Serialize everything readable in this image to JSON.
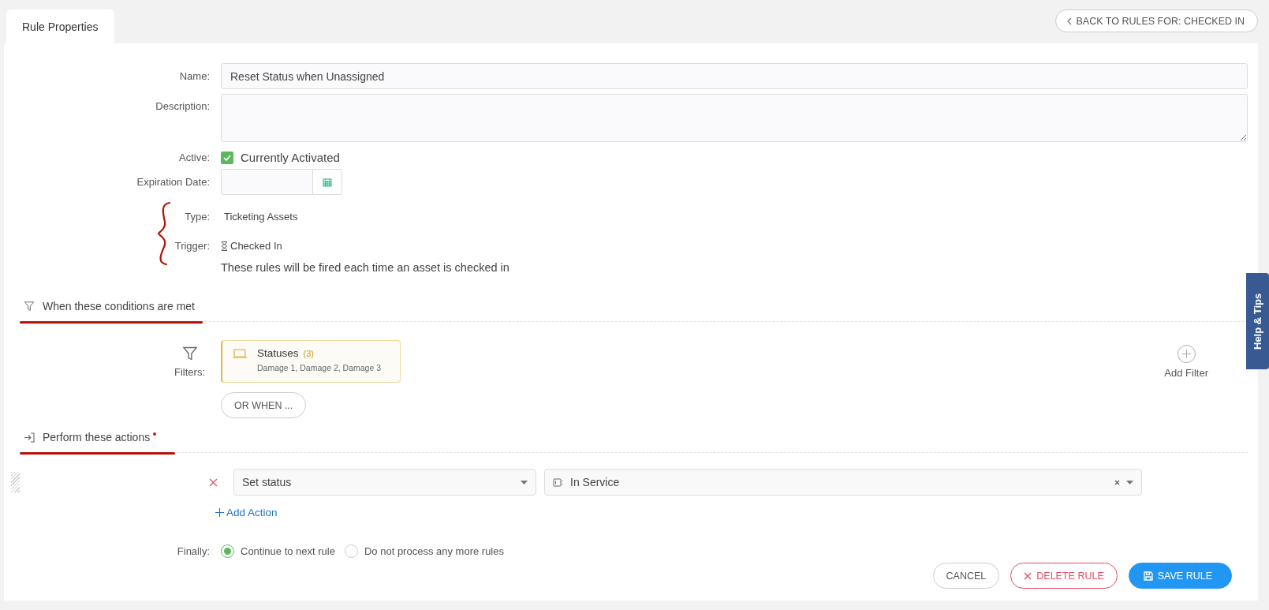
{
  "tabs": [
    {
      "label": "Rule Properties",
      "selected": true
    }
  ],
  "back_button": {
    "label": "BACK TO RULES FOR: CHECKED IN"
  },
  "form": {
    "name": {
      "label": "Name:",
      "value": "Reset Status when Unassigned"
    },
    "description": {
      "label": "Description:"
    },
    "active": {
      "label": "Active:",
      "text": "Currently Activated",
      "checked": true
    },
    "expiration": {
      "label": "Expiration Date:"
    },
    "type": {
      "label": "Type:",
      "value": "Ticketing Assets"
    },
    "trigger": {
      "label": "Trigger:",
      "value": "Checked In",
      "note": "These rules will be fired each time an asset is checked in"
    }
  },
  "conditions": {
    "title": "When these conditions are met",
    "filters_label": "Filters:",
    "filters": [
      {
        "name": "Statuses",
        "count": "(3)",
        "values": "Damage 1, Damage 2, Damage 3"
      }
    ],
    "or_when": "OR WHEN ...",
    "add_filter": "Add Filter"
  },
  "actions": {
    "title": "Perform these actions",
    "required": true,
    "items": [
      {
        "action": "Set status",
        "value": "In Service"
      }
    ],
    "add_action": "Add Action"
  },
  "finally": {
    "label": "Finally:",
    "options": [
      {
        "label": "Continue to next rule",
        "selected": true
      },
      {
        "label": "Do not process any more rules",
        "selected": false
      }
    ]
  },
  "buttons": [
    {
      "kind": "cancel",
      "label": "CANCEL"
    },
    {
      "kind": "delete",
      "label": "DELETE RULE"
    },
    {
      "kind": "save",
      "label": "SAVE RULE"
    }
  ],
  "help_tab": "Help & Tips"
}
